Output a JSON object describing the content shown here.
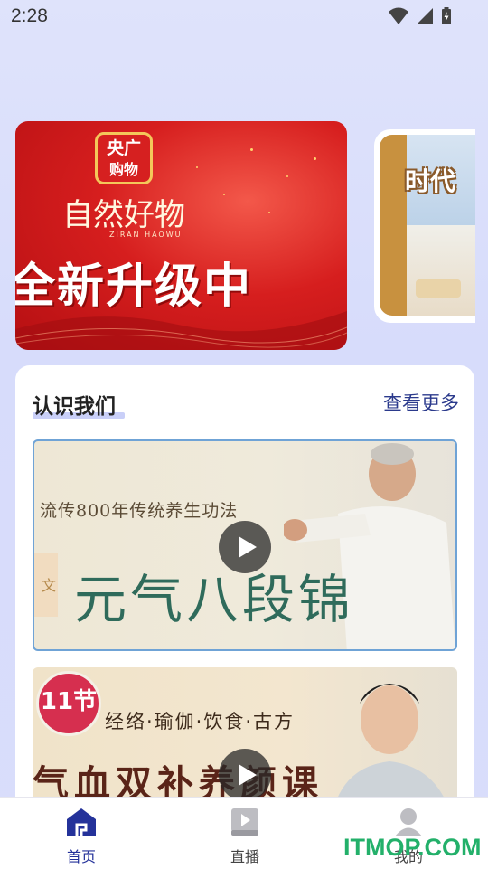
{
  "status": {
    "time": "2:28"
  },
  "banner": {
    "logo_line1": "央广",
    "logo_line2": "购物",
    "subtitle": "自然好物",
    "subtitle_small": "ZIRAN HAOWU",
    "headline": "全新升级中",
    "side_headline": "时代"
  },
  "section": {
    "title": "认识我们",
    "more": "查看更多"
  },
  "videos": [
    {
      "top_text": "流传800年传统养生功法",
      "main_text": "元气八段锦",
      "seal": "文"
    },
    {
      "badge": "11节",
      "sub_text": "经络·瑜伽·饮食·古方",
      "main_text": "气血双补养颜课"
    }
  ],
  "nav": {
    "items": [
      {
        "label": "首页",
        "icon": "home-icon",
        "active": true
      },
      {
        "label": "直播",
        "icon": "play-book-icon",
        "active": false
      },
      {
        "label": "我的",
        "icon": "user-icon",
        "active": false
      }
    ]
  },
  "watermark": "ITMOP.COM",
  "colors": {
    "accent": "#24329a",
    "watermark": "#23b06a"
  }
}
